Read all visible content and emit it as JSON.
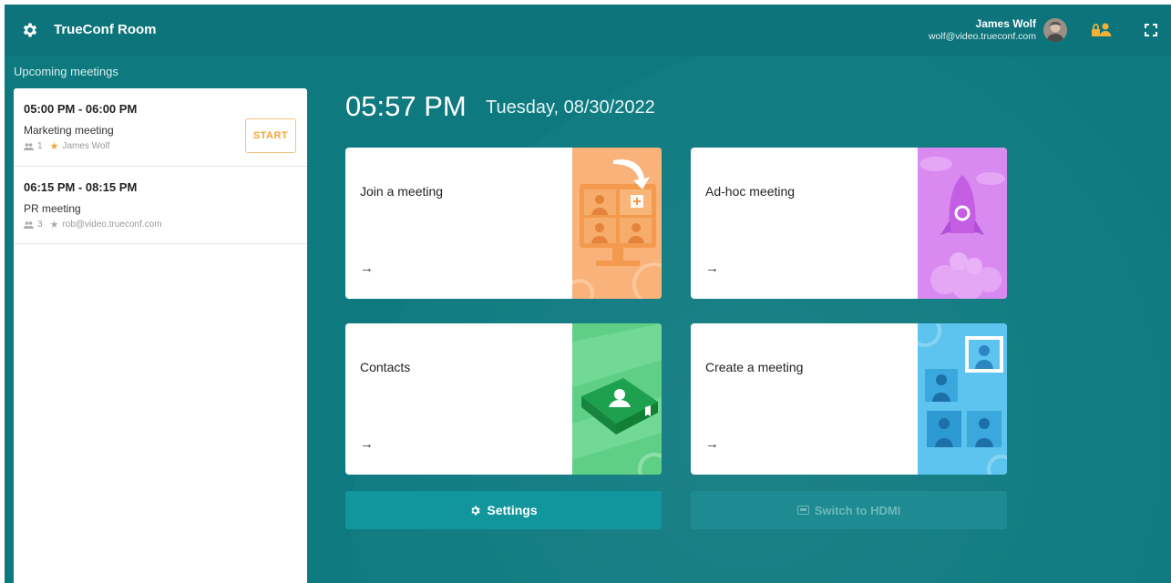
{
  "app": {
    "title": "TrueConf Room"
  },
  "user": {
    "name": "James Wolf",
    "email": "wolf@video.trueconf.com"
  },
  "sidebar": {
    "title": "Upcoming meetings",
    "meetings": [
      {
        "time": "05:00 PM - 06:00 PM",
        "name": "Marketing meeting",
        "participants": "1",
        "owner": "James Wolf",
        "action": "START"
      },
      {
        "time": "06:15 PM - 08:15 PM",
        "name": "PR meeting",
        "participants": "3",
        "owner": "rob@video.trueconf.com"
      }
    ]
  },
  "main": {
    "time": "05:57 PM",
    "date": "Tuesday, 08/30/2022",
    "cards": [
      {
        "label": "Join a meeting",
        "arrow": "→"
      },
      {
        "label": "Ad-hoc meeting",
        "arrow": "→"
      },
      {
        "label": "Contacts",
        "arrow": "→"
      },
      {
        "label": "Create a meeting",
        "arrow": "→"
      }
    ],
    "settings_label": "Settings",
    "hdmi_label": "Switch to HDMI"
  },
  "colors": {
    "background": "#0e7a80",
    "accent": "#12969d",
    "start": "#f2a535",
    "join_art": "#f5a86a",
    "adhoc_art": "#c96ee8",
    "contacts_art": "#3fbf6b",
    "create_art": "#4fb8e8"
  }
}
